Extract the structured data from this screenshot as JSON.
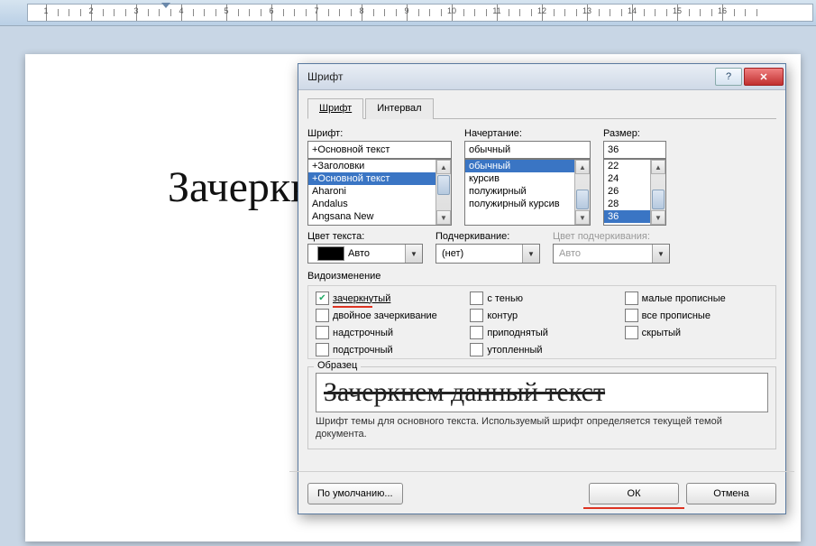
{
  "ruler": {
    "marks": [
      1,
      2,
      3,
      4,
      5,
      6,
      7,
      8,
      9,
      10,
      11,
      12,
      13,
      14,
      15,
      16
    ]
  },
  "document": {
    "text": "Зачеркнем данный текст."
  },
  "dialog": {
    "title": "Шрифт",
    "tabs": {
      "font": "Шрифт",
      "spacing": "Интервал"
    },
    "font": {
      "label": "Шрифт:",
      "value": "+Основной текст",
      "list": [
        "+Заголовки",
        "+Основной текст",
        "Aharoni",
        "Andalus",
        "Angsana New"
      ],
      "selected": "+Основной текст"
    },
    "style": {
      "label": "Начертание:",
      "value": "обычный",
      "list": [
        "обычный",
        "курсив",
        "полужирный",
        "полужирный курсив"
      ],
      "selected": "обычный"
    },
    "size": {
      "label": "Размер:",
      "value": "36",
      "list": [
        "22",
        "24",
        "26",
        "28",
        "36"
      ],
      "selected": "36"
    },
    "color_label": "Цвет текста:",
    "color_value": "Авто",
    "underline_label": "Подчеркивание:",
    "underline_value": "(нет)",
    "ucolor_label": "Цвет подчеркивания:",
    "ucolor_value": "Авто",
    "effects_label": "Видоизменение",
    "effects": {
      "strike": "зачеркнутый",
      "dstrike": "двойное зачеркивание",
      "superscript": "надстрочный",
      "subscript": "подстрочный",
      "shadow": "с тенью",
      "outline": "контур",
      "emboss": "приподнятый",
      "engrave": "утопленный",
      "smallcaps": "малые прописные",
      "allcaps": "все прописные",
      "hidden": "скрытый"
    },
    "sample_label": "Образец",
    "sample_text": "Зачеркнем данный текст",
    "sample_note": "Шрифт темы для основного текста. Используемый шрифт определяется текущей темой документа.",
    "buttons": {
      "default": "По умолчанию...",
      "ok": "ОК",
      "cancel": "Отмена"
    }
  }
}
